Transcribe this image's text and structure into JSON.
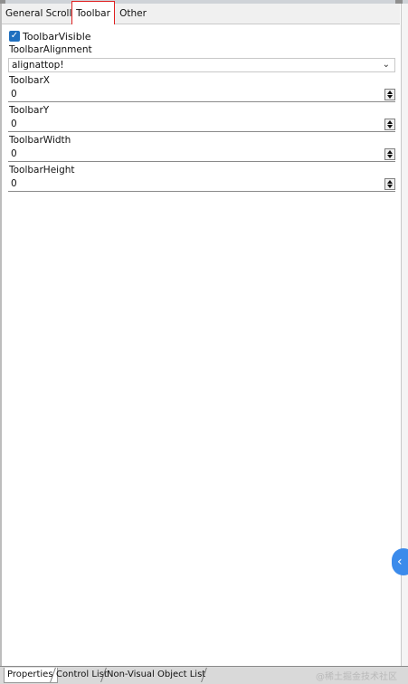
{
  "tabs": {
    "general": "General",
    "scroll": "Scroll",
    "toolbar": "Toolbar",
    "other": "Other",
    "active": "Toolbar"
  },
  "properties": {
    "toolbar_visible_label": "ToolbarVisible",
    "toolbar_visible_checked": true,
    "toolbar_alignment_label": "ToolbarAlignment",
    "toolbar_alignment_value": "alignattop!",
    "toolbar_x_label": "ToolbarX",
    "toolbar_x_value": "0",
    "toolbar_y_label": "ToolbarY",
    "toolbar_y_value": "0",
    "toolbar_width_label": "ToolbarWidth",
    "toolbar_width_value": "0",
    "toolbar_height_label": "ToolbarHeight",
    "toolbar_height_value": "0"
  },
  "bottom_tabs": {
    "properties": "Properties",
    "control_list": "Control List",
    "non_visual": "Non-Visual Object List"
  },
  "watermark": "@稀土掘金技术社区",
  "icons": {
    "checkbox": "checkmark-icon",
    "dropdown": "chevron-down-icon",
    "spinner": "spin-arrows-icon",
    "side_button": "chevron-left-icon"
  },
  "colors": {
    "accent_blue": "#3b8beb",
    "checkbox_blue": "#1f6fbf",
    "active_tab_border": "#e02020"
  }
}
